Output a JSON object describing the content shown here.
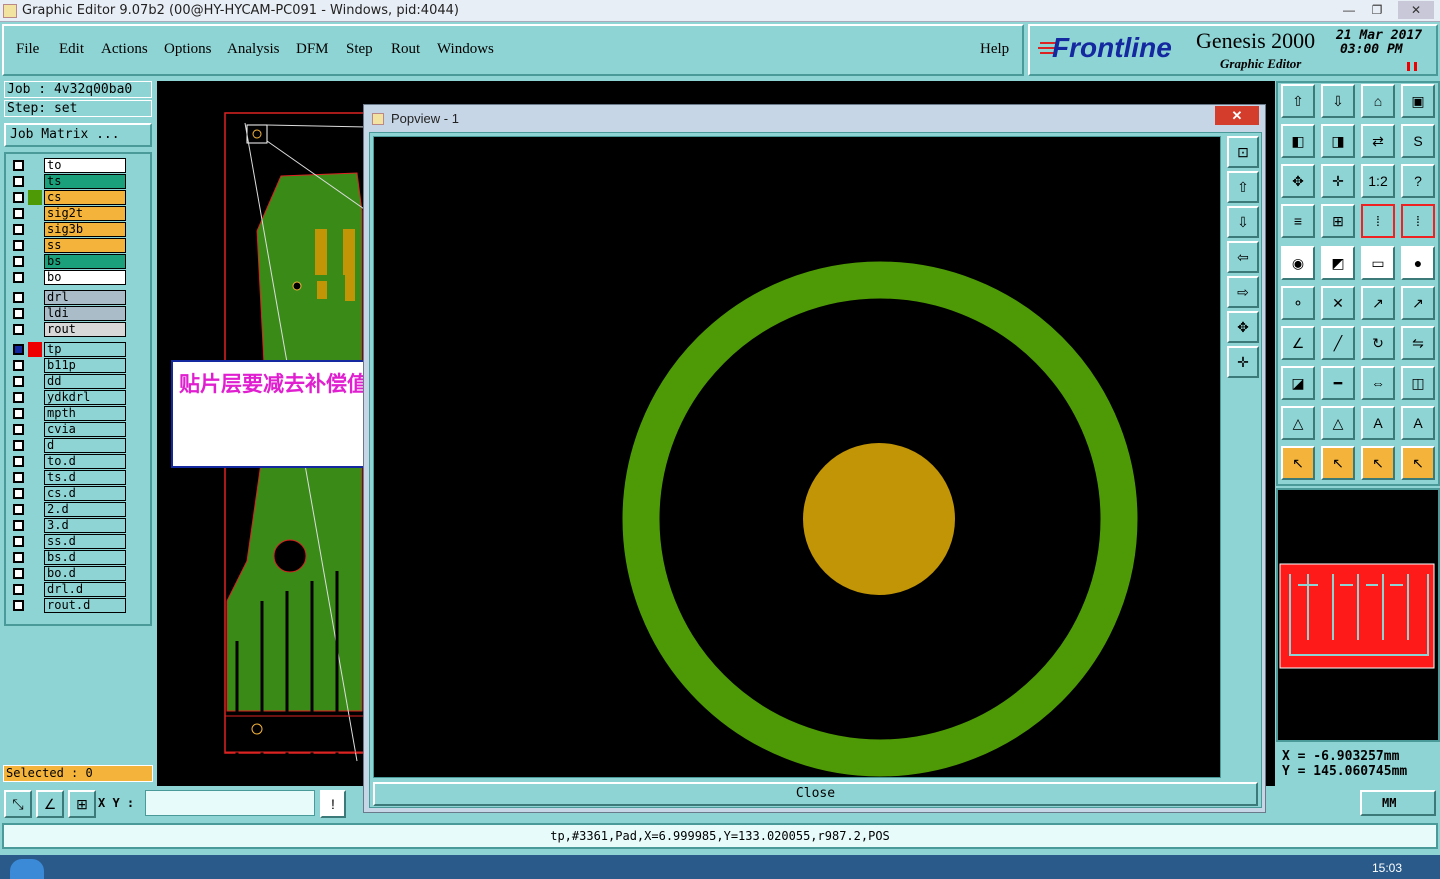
{
  "window": {
    "title": "Graphic Editor 9.07b2 (00@HY-HYCAM-PC091 - Windows, pid:4044)",
    "minimize": "—",
    "maximize": "❐",
    "close": "✕"
  },
  "menus": [
    "File",
    "Edit",
    "Actions",
    "Options",
    "Analysis",
    "DFM",
    "Step",
    "Rout",
    "Windows"
  ],
  "help": "Help",
  "brand": {
    "logo": "Frontline",
    "product": "Genesis 2000",
    "subtitle": "Graphic Editor",
    "date": "21 Mar 2017",
    "time": "03:00  PM"
  },
  "job": {
    "job_line": "Job : 4v32q00ba0",
    "step_line": "Step: set",
    "matrix_button": "Job Matrix ..."
  },
  "layers": {
    "board": [
      {
        "name": "to",
        "color": "#ffffff"
      },
      {
        "name": "ts",
        "color": "#1aa07a"
      },
      {
        "name": "cs",
        "color": "#f4b43c"
      },
      {
        "name": "sig2t",
        "color": "#f4b43c"
      },
      {
        "name": "sig3b",
        "color": "#f4b43c"
      },
      {
        "name": "ss",
        "color": "#f4b43c"
      },
      {
        "name": "bs",
        "color": "#1aa07a"
      },
      {
        "name": "bo",
        "color": "#ffffff"
      }
    ],
    "drill": [
      {
        "name": "drl",
        "color": "#a9bcc8"
      },
      {
        "name": "ldi",
        "color": "#a9bcc8"
      },
      {
        "name": "rout",
        "color": "#d8d8d8"
      }
    ],
    "misc": [
      {
        "name": "tp",
        "color": "#8fd4d4"
      },
      {
        "name": "b11p",
        "color": "#8fd4d4"
      },
      {
        "name": "dd",
        "color": "#8fd4d4"
      },
      {
        "name": "ydkdrl",
        "color": "#8fd4d4"
      },
      {
        "name": "mpth",
        "color": "#8fd4d4"
      },
      {
        "name": "cvia",
        "color": "#8fd4d4"
      },
      {
        "name": "d",
        "color": "#8fd4d4"
      },
      {
        "name": "to.d",
        "color": "#8fd4d4"
      },
      {
        "name": "ts.d",
        "color": "#8fd4d4"
      },
      {
        "name": "cs.d",
        "color": "#8fd4d4"
      },
      {
        "name": "2.d",
        "color": "#8fd4d4"
      },
      {
        "name": "3.d",
        "color": "#8fd4d4"
      },
      {
        "name": "ss.d",
        "color": "#8fd4d4"
      },
      {
        "name": "bs.d",
        "color": "#8fd4d4"
      },
      {
        "name": "bo.d",
        "color": "#8fd4d4"
      },
      {
        "name": "drl.d",
        "color": "#8fd4d4"
      },
      {
        "name": "rout.d",
        "color": "#8fd4d4"
      }
    ]
  },
  "annotation": "贴片层要减去补偿值",
  "selected": "Selected : 0",
  "xy_label": "X Y :",
  "popup": {
    "title": "Popview - 1",
    "close_label": "Close",
    "ring_color": "#4e9a06",
    "pad_color": "#c29506"
  },
  "coords": {
    "x": "X = -6.903257mm",
    "y": "Y = 145.060745mm"
  },
  "units": "MM",
  "status": "tp,#3361,Pad,X=6.999985,Y=133.020055,r987.2,POS",
  "clock": "15:03"
}
